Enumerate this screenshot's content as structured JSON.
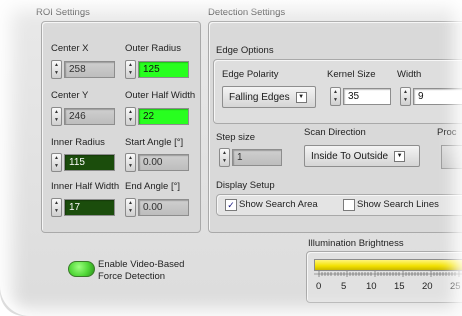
{
  "roi": {
    "title": "ROI Settings",
    "center_x_label": "Center X",
    "center_x_value": "258",
    "outer_radius_label": "Outer Radius",
    "outer_radius_value": "125",
    "center_y_label": "Center Y",
    "center_y_value": "246",
    "outer_half_width_label": "Outer Half Width",
    "outer_half_width_value": "22",
    "inner_radius_label": "Inner Radius",
    "inner_radius_value": "115",
    "start_angle_label": "Start Angle [°]",
    "start_angle_value": "0.00",
    "inner_half_width_label": "Inner Half Width",
    "inner_half_width_value": "17",
    "end_angle_label": "End Angle [°]",
    "end_angle_value": "0.00"
  },
  "detection": {
    "title": "Detection Settings",
    "edge_options_title": "Edge Options",
    "edge_polarity_label": "Edge Polarity",
    "edge_polarity_value": "Falling Edges",
    "kernel_size_label": "Kernel Size",
    "kernel_size_value": "35",
    "width_label": "Width",
    "width_value": "9",
    "step_size_label": "Step size",
    "step_size_value": "1",
    "scan_direction_label": "Scan Direction",
    "scan_direction_value": "Inside To Outside",
    "proc_label": "Proc",
    "display_setup_label": "Display Setup",
    "show_search_area_label": "Show Search Area",
    "show_search_area_checked": true,
    "show_search_lines_label": "Show Search Lines",
    "show_search_lines_checked": false
  },
  "video": {
    "toggle_label_line1": "Enable Video-Based",
    "toggle_label_line2": "Force Detection",
    "toggle_color": "#4fd636"
  },
  "illumination": {
    "title": "Illumination Brightness",
    "ticks": [
      "0",
      "5",
      "10",
      "15",
      "20",
      "25"
    ],
    "fill_color": "#f2e000"
  }
}
